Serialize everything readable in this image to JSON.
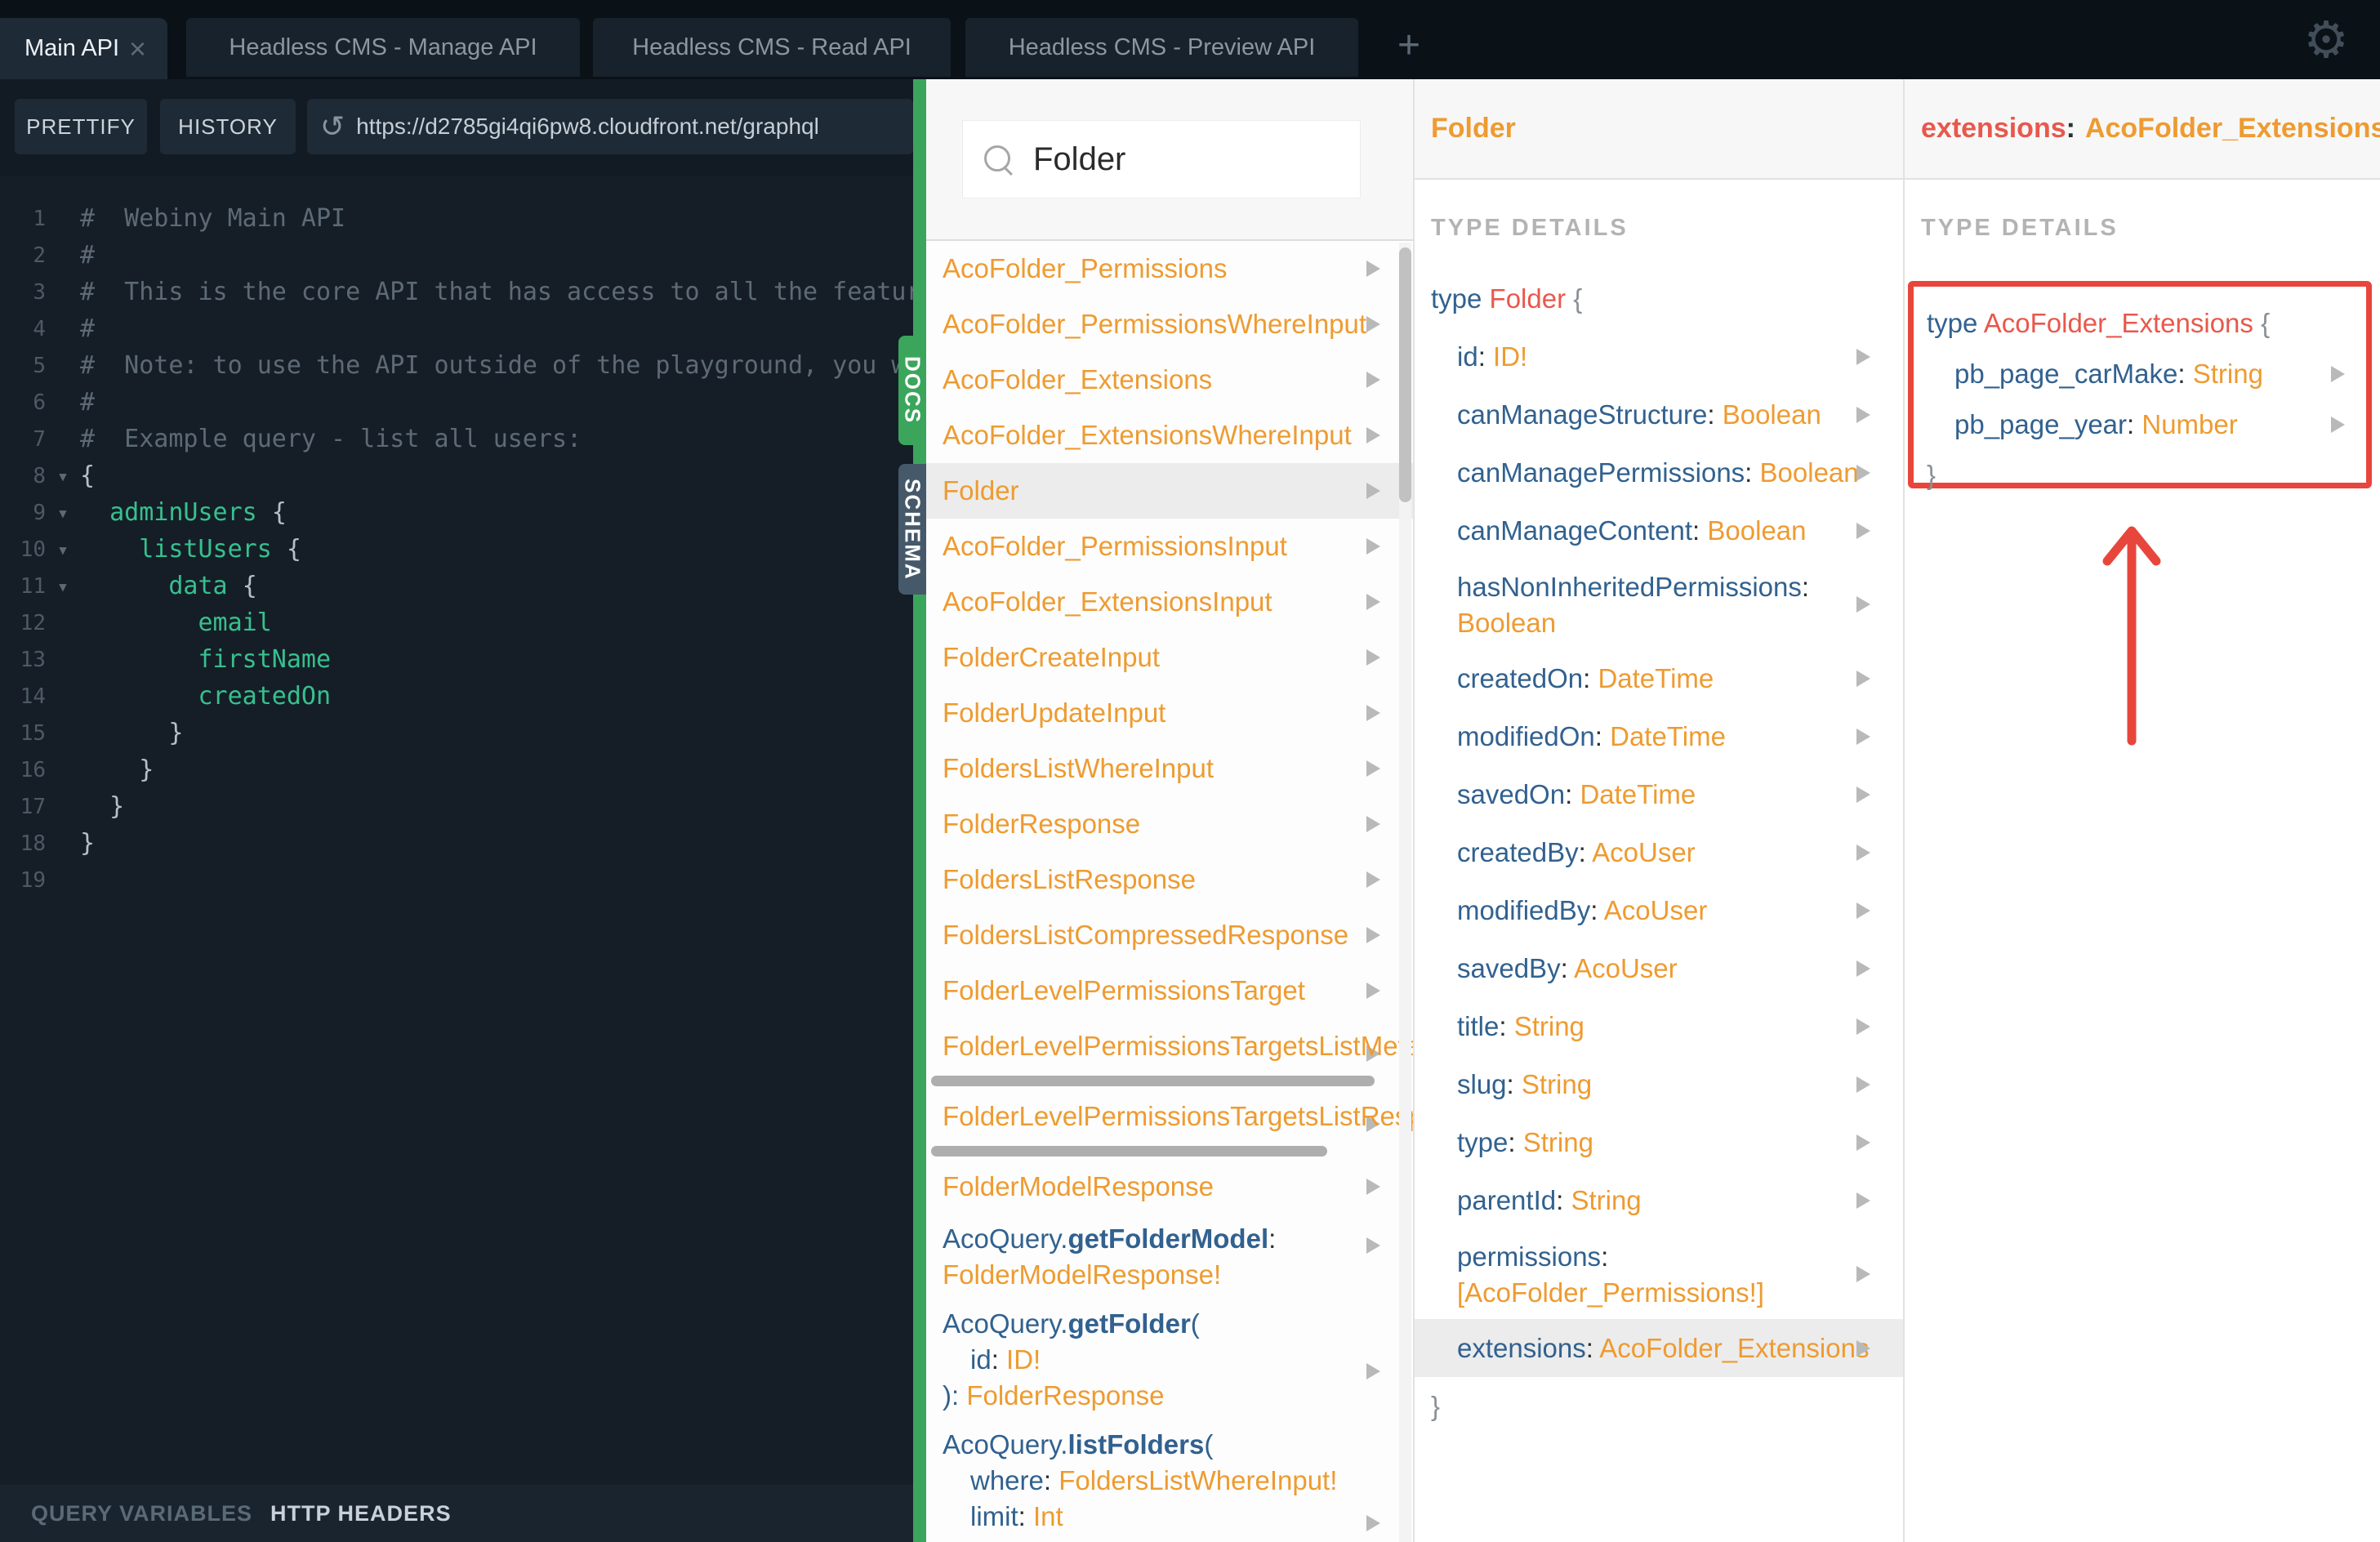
{
  "colors": {
    "accent_green": "#3ca55c",
    "docs_orange": "#ee9b31",
    "docs_blue": "#31618f",
    "docs_red": "#e8584c",
    "annotation_red": "#e8463c",
    "code_green": "#37c08d",
    "dark_background": "#151e27"
  },
  "icons": {
    "settings_gear": "⚙",
    "close_tab": "×",
    "new_tab": "+",
    "refresh": "↺",
    "fold_caret": "▾",
    "search": "magnifier",
    "expand_triangle": "right-triangle"
  },
  "topbar": {
    "tabs": [
      {
        "label": "Main API",
        "active": true,
        "closable": true
      },
      {
        "label": "Headless CMS - Manage API",
        "active": false
      },
      {
        "label": "Headless CMS - Read API",
        "active": false
      },
      {
        "label": "Headless CMS - Preview API",
        "active": false
      }
    ]
  },
  "toolbar": {
    "prettify_label": "PRETTIFY",
    "history_label": "HISTORY",
    "url": "https://d2785gi4qi6pw8.cloudfront.net/graphql"
  },
  "side_tabs": {
    "docs": "DOCS",
    "schema": "SCHEMA"
  },
  "bottombar": {
    "query_variables": "QUERY VARIABLES",
    "http_headers": "HTTP HEADERS"
  },
  "editor": {
    "lines": [
      {
        "n": "1",
        "comment": "#  Webiny Main API"
      },
      {
        "n": "2",
        "comment": "#"
      },
      {
        "n": "3",
        "comment": "#  This is the core API that has access to all the features"
      },
      {
        "n": "4",
        "comment": "#"
      },
      {
        "n": "5",
        "comment": "#  Note: to use the API outside of the playground, you will"
      },
      {
        "n": "6",
        "comment": "#"
      },
      {
        "n": "7",
        "comment": "#  Example query - list all users:"
      },
      {
        "n": "8",
        "fold_icon": "▾",
        "punct": "{"
      },
      {
        "n": "9",
        "fold_icon": "▾",
        "field": "  adminUsers ",
        "punct": "{"
      },
      {
        "n": "10",
        "fold_icon": "▾",
        "field": "    listUsers ",
        "punct": "{"
      },
      {
        "n": "11",
        "fold_icon": "▾",
        "field": "      data ",
        "punct": "{"
      },
      {
        "n": "12",
        "field": "        email"
      },
      {
        "n": "13",
        "field": "        firstName"
      },
      {
        "n": "14",
        "field": "        createdOn"
      },
      {
        "n": "15",
        "punct": "      }"
      },
      {
        "n": "16",
        "punct": "    }"
      },
      {
        "n": "17",
        "punct": "  }"
      },
      {
        "n": "18",
        "punct": "}"
      },
      {
        "n": "19"
      }
    ]
  },
  "punct": {
    "colon": ":",
    "open_paren": "(",
    "close_paren_colon": "):",
    "open_brace": "{",
    "close_brace": "}"
  },
  "docs": {
    "search_value": "Folder",
    "items": [
      {
        "label": "AcoFolder_Permissions"
      },
      {
        "label": "AcoFolder_PermissionsWhereInput"
      },
      {
        "label": "AcoFolder_Extensions"
      },
      {
        "label": "AcoFolder_ExtensionsWhereInput"
      },
      {
        "label": "Folder",
        "selected": true
      },
      {
        "label": "AcoFolder_PermissionsInput"
      },
      {
        "label": "AcoFolder_ExtensionsInput"
      },
      {
        "label": "FolderCreateInput"
      },
      {
        "label": "FolderUpdateInput"
      },
      {
        "label": "FoldersListWhereInput"
      },
      {
        "label": "FolderResponse"
      },
      {
        "label": "FoldersListResponse"
      },
      {
        "label": "FoldersListCompressedResponse"
      },
      {
        "label": "FolderLevelPermissionsTarget"
      },
      {
        "label": "FolderLevelPermissionsTargetsListMeta"
      },
      {
        "label": "FolderLevelPermissionsTargetsListResponse"
      },
      {
        "label": "FolderModelResponse"
      }
    ],
    "queries": [
      {
        "ns": "AcoQuery.",
        "method": "getFolderModel",
        "ret": "FolderModelResponse!"
      },
      {
        "ns": "AcoQuery.",
        "method": "getFolder",
        "arg1_name": "id",
        "arg1_type": "ID!",
        "ret": "FolderResponse"
      },
      {
        "ns": "AcoQuery.",
        "method": "listFolders",
        "arg1_name": "where",
        "arg1_type": "FoldersListWhereInput!",
        "arg2_name": "limit",
        "arg2_type": "Int"
      }
    ]
  },
  "folder_type": {
    "title": "Folder",
    "section_label": "TYPE DETAILS",
    "decl_kw": "type",
    "decl_name": "Folder",
    "fields": [
      {
        "name": "id",
        "type": "ID!"
      },
      {
        "name": "canManageStructure",
        "type": "Boolean"
      },
      {
        "name": "canManagePermissions",
        "type": "Boolean"
      },
      {
        "name": "canManageContent",
        "type": "Boolean"
      },
      {
        "name": "hasNonInheritedPermissions",
        "type": "Boolean",
        "wrap": true
      },
      {
        "name": "createdOn",
        "type": "DateTime"
      },
      {
        "name": "modifiedOn",
        "type": "DateTime"
      },
      {
        "name": "savedOn",
        "type": "DateTime"
      },
      {
        "name": "createdBy",
        "type": "AcoUser"
      },
      {
        "name": "modifiedBy",
        "type": "AcoUser"
      },
      {
        "name": "savedBy",
        "type": "AcoUser"
      },
      {
        "name": "title",
        "type": "String"
      },
      {
        "name": "slug",
        "type": "String"
      },
      {
        "name": "type",
        "type": "String"
      },
      {
        "name": "parentId",
        "type": "String"
      },
      {
        "name": "permissions",
        "type": "[AcoFolder_Permissions!]",
        "wrap": true
      },
      {
        "name": "extensions",
        "type": "AcoFolder_Extensions",
        "selected": true
      }
    ]
  },
  "extensions_type": {
    "title_field": "extensions",
    "title_type": "AcoFolder_Extensions",
    "section_label": "TYPE DETAILS",
    "decl_kw": "type",
    "decl_name": "AcoFolder_Extensions",
    "fields": [
      {
        "name": "pb_page_carMake",
        "type": "String"
      },
      {
        "name": "pb_page_year",
        "type": "Number"
      }
    ]
  }
}
